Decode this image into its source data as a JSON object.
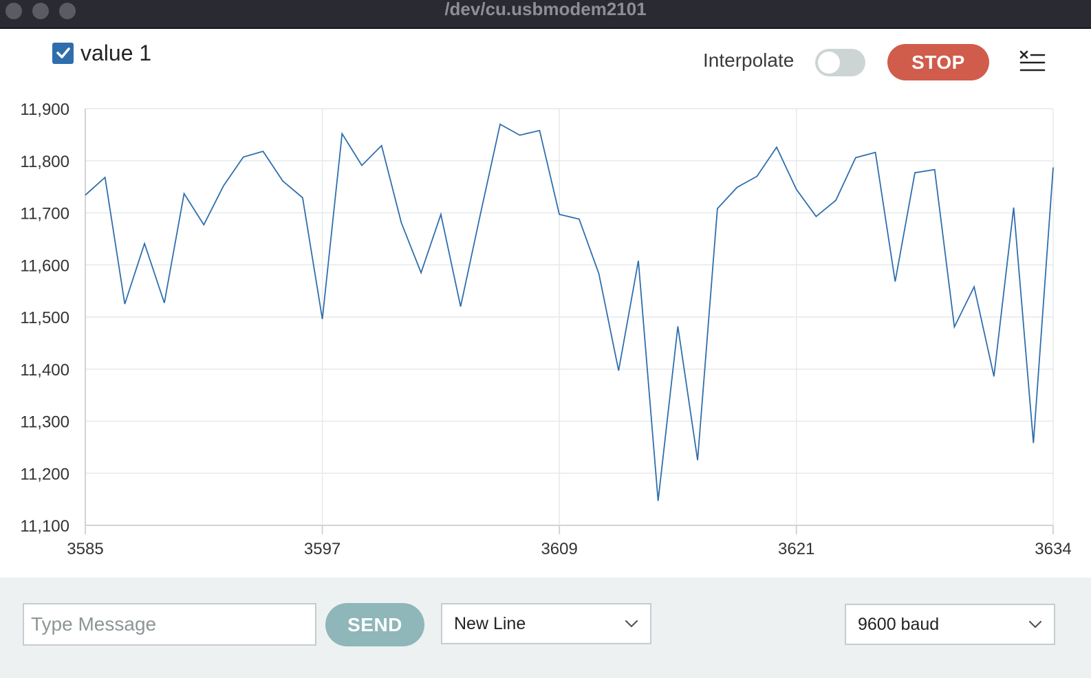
{
  "window": {
    "title": "/dev/cu.usbmodem2101"
  },
  "legend": {
    "series_label": "value 1",
    "checked": true
  },
  "controls": {
    "interpolate_label": "Interpolate",
    "interpolate_on": false,
    "stop_label": "STOP"
  },
  "bottom_bar": {
    "message_placeholder": "Type Message",
    "send_label": "SEND",
    "line_ending": "New Line",
    "baud_rate": "9600 baud"
  },
  "colors": {
    "series": "#2f6ead",
    "stop": "#d05c4b",
    "send": "#8fb6b8",
    "grid": "#e6e9ea"
  },
  "chart_data": {
    "type": "line",
    "title": "",
    "xlabel": "",
    "ylabel": "",
    "xlim": [
      3585,
      3634
    ],
    "ylim": [
      11100,
      11900
    ],
    "x_ticks": [
      "3585",
      "3597",
      "3609",
      "3621",
      "3634"
    ],
    "y_ticks": [
      "11,900",
      "11,800",
      "11,700",
      "11,600",
      "11,500",
      "11,400",
      "11,300",
      "11,200",
      "11,100"
    ],
    "grid": true,
    "series": [
      {
        "name": "value 1",
        "x": [
          3585,
          3586,
          3587,
          3588,
          3589,
          3590,
          3591,
          3592,
          3593,
          3594,
          3595,
          3596,
          3597,
          3598,
          3599,
          3600,
          3601,
          3602,
          3603,
          3604,
          3605,
          3606,
          3607,
          3608,
          3609,
          3610,
          3611,
          3612,
          3613,
          3614,
          3615,
          3616,
          3617,
          3618,
          3619,
          3620,
          3621,
          3622,
          3623,
          3624,
          3625,
          3626,
          3627,
          3628,
          3629,
          3630,
          3631,
          3632,
          3633,
          3634
        ],
        "values": [
          11734,
          11768,
          11525,
          11641,
          11527,
          11737,
          11677,
          11752,
          11807,
          11818,
          11761,
          11729,
          11496,
          11852,
          11791,
          11829,
          11681,
          11585,
          11697,
          11520,
          11697,
          11870,
          11849,
          11858,
          11697,
          11688,
          11583,
          11397,
          11608,
          11147,
          11482,
          11225,
          11708,
          11749,
          11770,
          11826,
          11745,
          11693,
          11724,
          11806,
          11816,
          11568,
          11777,
          11783,
          11481,
          11558,
          11386,
          11710,
          11258,
          11787
        ]
      }
    ]
  }
}
